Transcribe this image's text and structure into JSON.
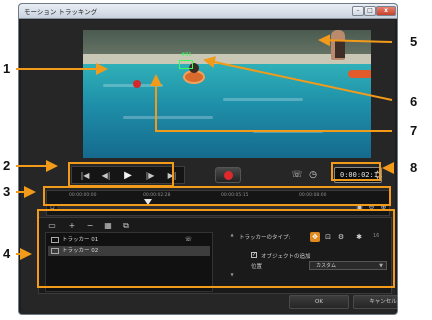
{
  "window": {
    "title": "モーション トラッキング",
    "minimize_glyph": "–",
    "maximize_glyph": "□",
    "close_glyph": "x"
  },
  "video": {
    "tracker_label": "#01"
  },
  "playback": {
    "buttons": [
      {
        "name": "go-to-start-button",
        "glyph": "|◀"
      },
      {
        "name": "step-back-button",
        "glyph": "◀|"
      },
      {
        "name": "play-button",
        "glyph": "▶"
      },
      {
        "name": "step-forward-button",
        "glyph": "|▶"
      },
      {
        "name": "go-to-end-button",
        "glyph": "▶|"
      }
    ],
    "timecode": "0:00:02:11"
  },
  "timeline": {
    "ticks": [
      "00:00:00:00",
      "00:00:02:28",
      "00:00:05:15",
      "00:00:08:00"
    ]
  },
  "tracker_panel": {
    "toolbar": {
      "add": "+",
      "remove": "−"
    },
    "trackers": [
      {
        "label": "トラッカー 01",
        "selected": false
      },
      {
        "label": "トラッカー 02",
        "selected": true
      }
    ],
    "tracker_type_label": "トラッカーのタイプ:",
    "add_object_label": "オブジェクトの追加",
    "add_object_checked": true,
    "position_label": "位置",
    "position_value": "カスタム",
    "spinner_value": "16"
  },
  "buttons": {
    "ok": "OK",
    "cancel": "キャンセル"
  },
  "callouts": [
    "1",
    "2",
    "3",
    "4",
    "5",
    "6",
    "7",
    "8"
  ],
  "colors": {
    "highlight": "#f29a1a",
    "record": "#e0282d",
    "tracker_marker": "#38ff5a",
    "active_type": "#e08a1e"
  }
}
